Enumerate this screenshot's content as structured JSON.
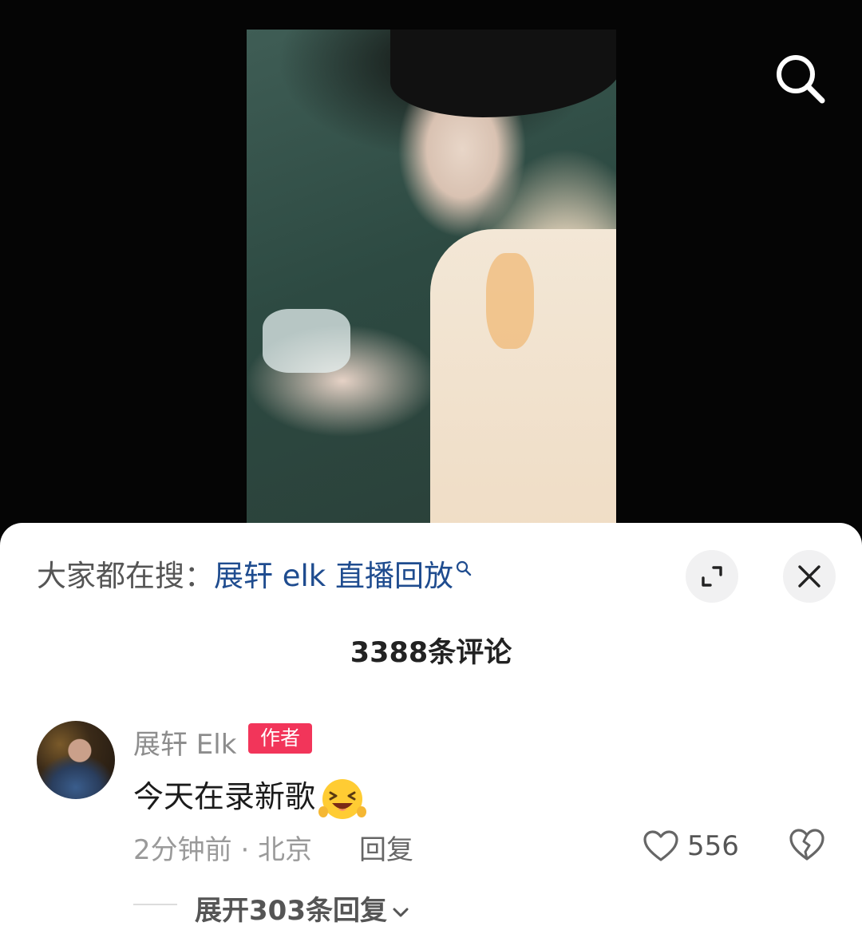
{
  "video": {
    "search_icon": "search-icon"
  },
  "comments_panel": {
    "trending_prefix": "大家都在搜：",
    "trending_query": "展轩 elk 直播回放",
    "trending_icon": "search-icon",
    "expand_icon": "expand-icon",
    "close_icon": "close-icon",
    "comment_count": "3388条评论",
    "comments": [
      {
        "avatar_icon": "avatar",
        "username": "展轩 Elk",
        "badge": "作者",
        "text": "今天在录新歌",
        "emoji": "grinning-squinting-face-emoji",
        "time_location": "2分钟前 · 北京",
        "reply_label": "回复",
        "like_icon": "heart-icon",
        "likes": "556",
        "dislike_icon": "broken-heart-icon",
        "expand_replies_label": "展开303条回复",
        "expand_chevron_icon": "chevron-down-icon"
      }
    ]
  },
  "colors": {
    "accent_blue": "#1f4c8f",
    "author_badge": "#f2355a",
    "background_dark": "#050505",
    "sheet_background": "#ffffff"
  }
}
